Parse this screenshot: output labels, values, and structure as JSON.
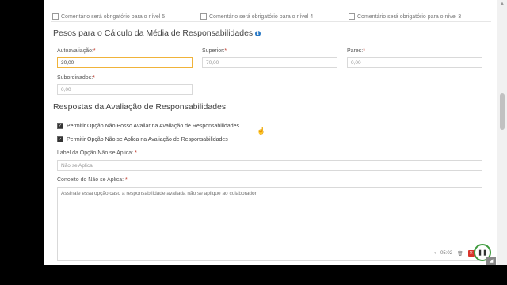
{
  "top_cut_checkboxes": [
    {
      "label": "Comentário será obrigatório para o nível 5"
    },
    {
      "label": "Comentário será obrigatório para o nível 4"
    },
    {
      "label": "Comentário será obrigatório para o nível 3"
    }
  ],
  "weights": {
    "title": "Pesos para o Cálculo da Média de Responsabilidades",
    "info_icon": "info-icon",
    "fields": [
      {
        "label": "Autoavaliação:",
        "value": "30,00"
      },
      {
        "label": "Superior:",
        "value": "70,00"
      },
      {
        "label": "Pares:",
        "value": "0,00"
      },
      {
        "label": "Subordinados:",
        "value": "0,00"
      }
    ],
    "required_mark": "*"
  },
  "answers": {
    "title": "Respostas da Avaliação de Responsabilidades",
    "checkboxes": [
      {
        "label": "Permitir Opção Não Posso Avaliar na Avaliação de Responsabilidades",
        "checked": true
      },
      {
        "label": "Permitir Opção Não se Aplica na Avaliação de Responsabilidades",
        "checked": true
      }
    ],
    "option_label": {
      "label": "Label da Opção Não se Aplica:",
      "value": "Não se Aplica"
    },
    "concept": {
      "label": "Conceito do Não se Aplica:",
      "value": "Assinale essa opção caso a responsabilidade avaliada não se aplique ao colaborador."
    }
  },
  "player": {
    "time": "05:02",
    "icons": [
      "chevron-left-icon",
      "trash-icon",
      "delete-icon",
      "pause-icon"
    ]
  },
  "colors": {
    "active_border": "#f0b33a",
    "required": "#c0392b",
    "info": "#2a79c5",
    "record_ring": "#3c9a3c"
  }
}
